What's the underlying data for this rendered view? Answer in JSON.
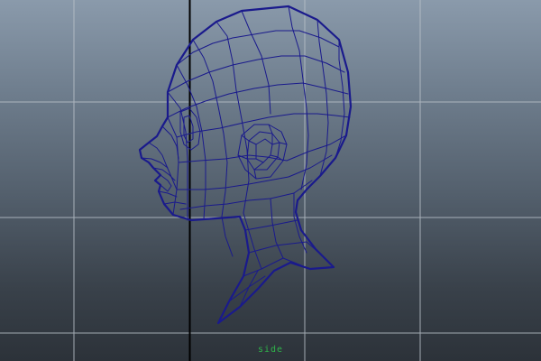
{
  "viewport": {
    "camera_label": "side",
    "background_top": "#8a9aab",
    "background_bottom": "#2c3239",
    "grid_color": "#b8c0c8",
    "axis_color": "#000000",
    "wireframe_color": "#1a1a8c"
  },
  "model": {
    "type": "polygon-head-wireframe",
    "view": "side-profile"
  }
}
